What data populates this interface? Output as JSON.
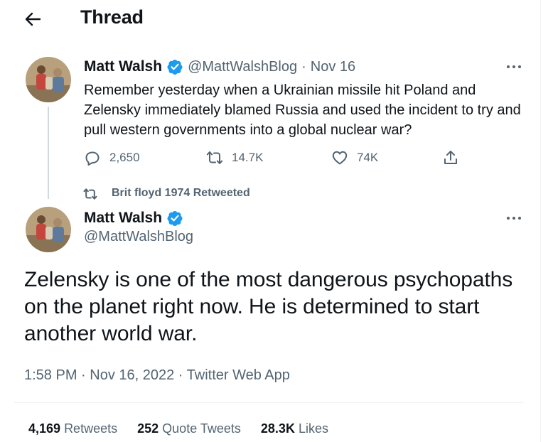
{
  "header": {
    "title": "Thread",
    "back_icon": "arrow-left-icon"
  },
  "colors": {
    "verified": "#1d9bf0",
    "muted": "#536471",
    "text": "#0f1419"
  },
  "parent_tweet": {
    "author_name": "Matt Walsh",
    "handle": "@MattWalshBlog",
    "separator": "·",
    "date": "Nov 16",
    "text": "Remember yesterday when a Ukrainian missile hit Poland and Zelensky immediately blamed Russia and used the incident to try and pull western governments into a global nuclear war?",
    "replies": "2,650",
    "retweets": "14.7K",
    "likes": "74K",
    "icons": [
      "reply-icon",
      "retweet-icon",
      "like-icon",
      "share-icon"
    ]
  },
  "retweet_context": {
    "label": "Brit floyd 1974 Retweeted"
  },
  "main_tweet": {
    "author_name": "Matt Walsh",
    "handle": "@MattWalshBlog",
    "text": "Zelensky is one of the most dangerous psychopaths on the planet right now. He is determined to start another world war.",
    "meta": "1:58 PM · Nov 16, 2022 · Twitter Web App",
    "stats": [
      {
        "count": "4,169",
        "label": "Retweets"
      },
      {
        "count": "252",
        "label": "Quote Tweets"
      },
      {
        "count": "28.3K",
        "label": "Likes"
      }
    ]
  }
}
